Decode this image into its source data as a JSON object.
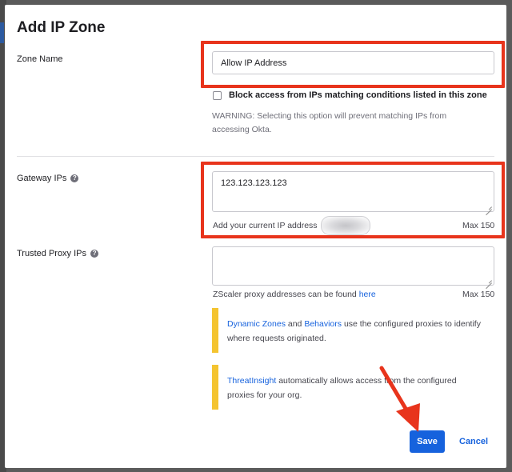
{
  "dialog": {
    "title": "Add IP Zone"
  },
  "zone_name": {
    "label": "Zone Name",
    "value": "Allow IP Address",
    "block_checkbox_label": "Block access from IPs matching conditions listed in this zone",
    "block_checked": false,
    "warning_line1": "WARNING: Selecting this option will prevent matching IPs from",
    "warning_line2": "accessing Okta."
  },
  "gateway_ips": {
    "label": "Gateway IPs",
    "value": "123.123.123.123",
    "hint": "Add your current IP address",
    "max": "Max 150"
  },
  "trusted_proxy_ips": {
    "label": "Trusted Proxy IPs",
    "value": "",
    "hint_prefix": "ZScaler proxy addresses can be found",
    "hint_link": "here",
    "max": "Max 150"
  },
  "callouts": [
    {
      "link1": "Dynamic Zones",
      "and": "and",
      "link2": "Behaviors",
      "text_rest": "use the configured proxies to identify",
      "line2": "where requests originated."
    },
    {
      "link": "ThreatInsight",
      "text_rest": "automatically allows access from the configured",
      "line2": "proxies for your org."
    }
  ],
  "buttons": {
    "save": "Save",
    "cancel": "Cancel"
  },
  "icons": {
    "help": "help-circle-icon",
    "resize": "resize-handle-icon",
    "arrow": "annotation-arrow-icon"
  },
  "colors": {
    "primary": "#1662dd",
    "annotation_red": "#e8341c",
    "callout_yellow": "#f4c430"
  }
}
